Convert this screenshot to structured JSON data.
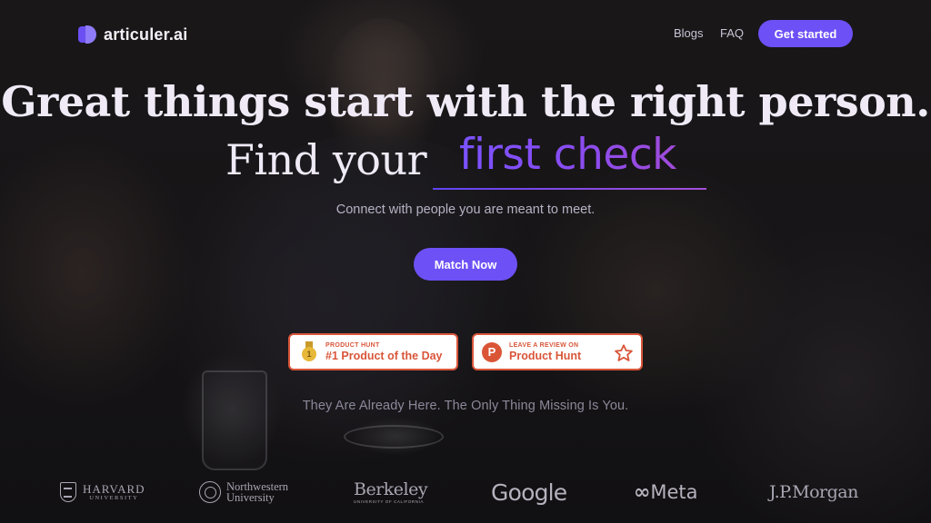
{
  "header": {
    "brand": "articuler.ai",
    "nav": {
      "blogs": "Blogs",
      "faq": "FAQ"
    },
    "cta": "Get started"
  },
  "hero": {
    "headline": "Great things start with the right person.",
    "line2_prefix": "Find your",
    "highlight": "first check",
    "subhead": "Connect with people you are meant to meet.",
    "button": "Match Now"
  },
  "badges": [
    {
      "small": "PRODUCT HUNT",
      "big": "#1 Product of the Day",
      "medal_number": "1"
    },
    {
      "small": "LEAVE A REVIEW ON",
      "big": "Product Hunt",
      "icon_letter": "P"
    }
  ],
  "tagline": "They Are Already Here. The Only Thing Missing Is You.",
  "logos": {
    "harvard": {
      "name": "HARVARD",
      "sub": "UNIVERSITY"
    },
    "northwestern": {
      "line1": "Northwestern",
      "line2": "University"
    },
    "berkeley": {
      "name": "Berkeley",
      "sub": "UNIVERSITY OF CALIFORNIA"
    },
    "google": "Google",
    "meta": {
      "mark": "∞",
      "name": "Meta"
    },
    "jpmorgan": "J.P.Morgan"
  },
  "colors": {
    "accent": "#6d51f6",
    "highlight_gradient_start": "#7a52ff",
    "highlight_gradient_end": "#a04bd8",
    "badge_red": "#d9563a",
    "background": "#141216"
  }
}
